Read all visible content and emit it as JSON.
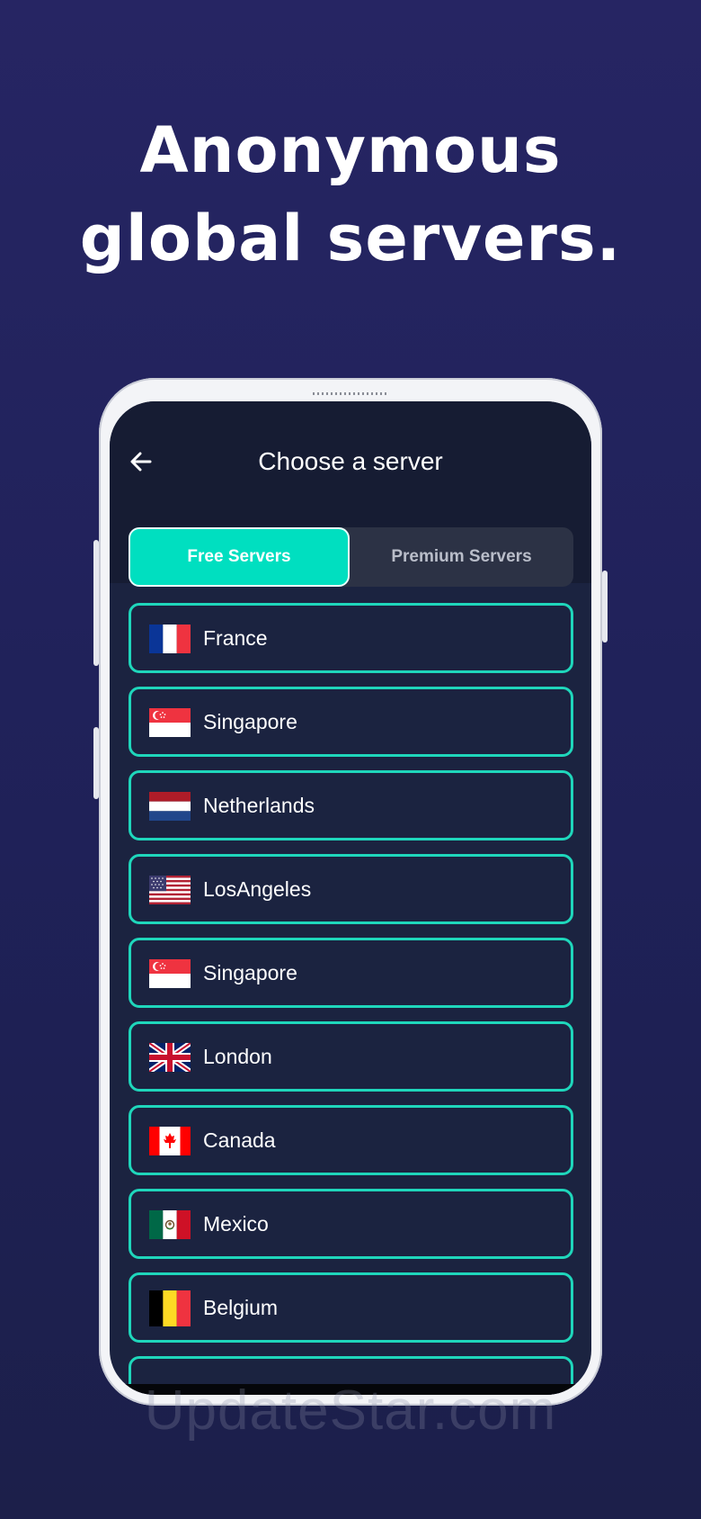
{
  "promo": {
    "headline_line1": "Anonymous",
    "headline_line2": "global servers."
  },
  "app": {
    "title": "Choose a server",
    "back_icon": "arrow-left-icon",
    "tabs": [
      {
        "label": "Free Servers",
        "active": true
      },
      {
        "label": "Premium Servers",
        "active": false
      }
    ],
    "servers": [
      {
        "name": "France",
        "flag": "flag-france-icon"
      },
      {
        "name": "Singapore",
        "flag": "flag-singapore-icon"
      },
      {
        "name": "Netherlands",
        "flag": "flag-netherlands-icon"
      },
      {
        "name": "LosAngeles",
        "flag": "flag-usa-icon"
      },
      {
        "name": "Singapore",
        "flag": "flag-singapore-icon"
      },
      {
        "name": "London",
        "flag": "flag-uk-icon"
      },
      {
        "name": "Canada",
        "flag": "flag-canada-icon"
      },
      {
        "name": "Mexico",
        "flag": "flag-mexico-icon"
      },
      {
        "name": "Belgium",
        "flag": "flag-belgium-icon"
      }
    ]
  },
  "watermark": "UpdateStar.com",
  "colors": {
    "background": "#262563",
    "accent": "#00dfc0",
    "item_border": "#1fd6bb",
    "screen_bg": "#1b2340",
    "header_bg": "#161c33"
  }
}
